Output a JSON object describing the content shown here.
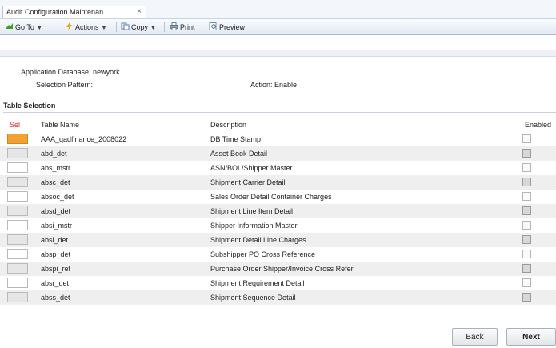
{
  "tab": {
    "title": "Audit Configuration Maintenan...",
    "close": "×"
  },
  "toolbar": {
    "goto_label": "Go To",
    "actions_label": "Actions",
    "copy_label": "Copy",
    "print_label": "Print",
    "preview_label": "Preview"
  },
  "info": {
    "app_db": "Application Database: newyork",
    "selection_pattern": "Selection Pattern:",
    "action": "Action: Enable"
  },
  "section_title": "Table Selection",
  "columns": {
    "sel": "Sel",
    "name": "Table Name",
    "desc": "Description",
    "enabled": "Enabled"
  },
  "rows": [
    {
      "name": "AAA_qadfinance_2008022",
      "desc": "DB Time Stamp",
      "selected": true,
      "enabled": false
    },
    {
      "name": "abd_det",
      "desc": "Asset Book Detail",
      "selected": false,
      "enabled": true
    },
    {
      "name": "abs_mstr",
      "desc": "ASN/BOL/Shipper Master",
      "selected": false,
      "enabled": false
    },
    {
      "name": "absc_det",
      "desc": "Shipment Carrier Detail",
      "selected": false,
      "enabled": true
    },
    {
      "name": "absoc_det",
      "desc": "Sales Order Detail Container Charges",
      "selected": false,
      "enabled": false
    },
    {
      "name": "absd_det",
      "desc": "Shipment Line Item Detail",
      "selected": false,
      "enabled": true
    },
    {
      "name": "absi_mstr",
      "desc": "Shipper Information Master",
      "selected": false,
      "enabled": false
    },
    {
      "name": "absl_det",
      "desc": "Shipment Detail Line Charges",
      "selected": false,
      "enabled": true
    },
    {
      "name": "absp_det",
      "desc": "Subshipper PO Cross Reference",
      "selected": false,
      "enabled": false
    },
    {
      "name": "abspi_ref",
      "desc": "Purchase Order Shipper/Invoice Cross Refer",
      "selected": false,
      "enabled": true
    },
    {
      "name": "absr_det",
      "desc": "Shipment Requirement Detail",
      "selected": false,
      "enabled": false
    },
    {
      "name": "abss_det",
      "desc": "Shipment Sequence Detail",
      "selected": false,
      "enabled": true
    }
  ],
  "buttons": {
    "back": "Back",
    "next": "Next"
  },
  "colors": {
    "selected_cell": "#f2a234",
    "sel_header": "#d9261c"
  }
}
